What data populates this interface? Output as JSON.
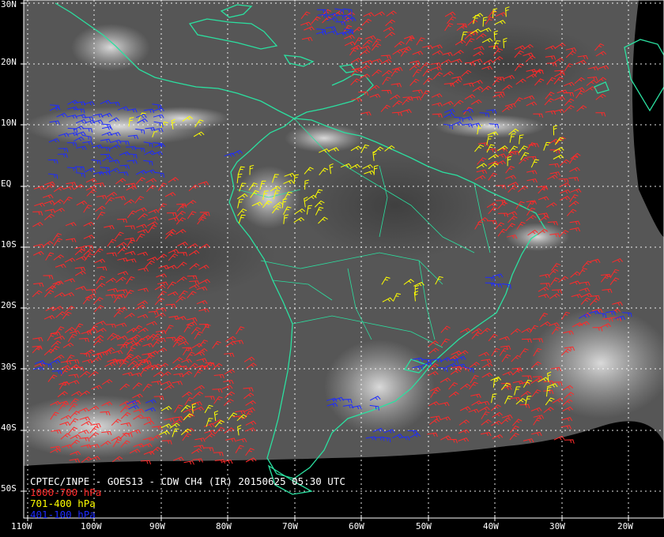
{
  "caption": {
    "title": "CPTEC/INPE - GOES13 - CDW CH4 (IR) 20150625 05:30 UTC",
    "legend": [
      {
        "label": "1000-700 hPa",
        "color": "#ff2a2a"
      },
      {
        "label": "701-400 hPa",
        "color": "#ffff00"
      },
      {
        "label": "401-100 hPa",
        "color": "#1e2cff"
      }
    ]
  },
  "lat_labels": [
    "30N",
    "20N",
    "10N",
    "EQ",
    "10S",
    "20S",
    "30S",
    "40S",
    "50S"
  ],
  "lon_labels": [
    "110W",
    "100W",
    "90W",
    "80W",
    "70W",
    "60W",
    "50W",
    "40W",
    "30W",
    "20W"
  ],
  "colors": {
    "coastline": "#2be0a0",
    "grid": "#ffffff",
    "background": "#000000",
    "satellite": "#5a5a5a"
  }
}
